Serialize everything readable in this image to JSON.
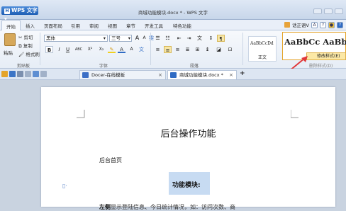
{
  "app": {
    "logo_letter": "H",
    "name": "WPS 文字",
    "title": "商城功能模块.docx * - WPS 文字"
  },
  "menu": {
    "tabs": [
      "开始",
      "插入",
      "页面布局",
      "引用",
      "审阅",
      "视图",
      "章节",
      "开发工具",
      "特色功能"
    ],
    "right_label": "话正语V",
    "right_icons": [
      "A",
      "?",
      "●",
      "?"
    ]
  },
  "ribbon": {
    "clipboard": {
      "paste": "粘贴",
      "cut": "剪切",
      "copy": "复制",
      "format_painter": "格式刷",
      "group": "剪贴板"
    },
    "font": {
      "family": "黑体",
      "size": "三号",
      "grow": "A",
      "shrink": "A",
      "bold": "B",
      "italic": "I",
      "underline": "U",
      "abc": "ABC",
      "superscript": "X²",
      "subscript": "X₂",
      "font_color": "A",
      "group": "字体"
    },
    "paragraph": {
      "group": "段落"
    },
    "styles": {
      "s1_sample": "AaBbCcDd",
      "s1_name": "正文",
      "s2_sample": "AaBbCc AaBb",
      "modify": "修改样式(E)",
      "delete": "删除样式(D)"
    }
  },
  "tabs": {
    "docer": "Docer-在线模板",
    "doc": "商城功能模块.docx *",
    "add": "+"
  },
  "document": {
    "title": "后台操作功能",
    "home": "后台首页",
    "module_label": "功能模块:",
    "para_mark": "▯·",
    "body_bold": "左侧",
    "body_rest": "显示登陆信息、今日统计情况，如：访问次数、商"
  },
  "colors": {
    "accent": "#2f6bc4",
    "highlight": "#c7dbf2",
    "arrow": "#e0393b"
  }
}
